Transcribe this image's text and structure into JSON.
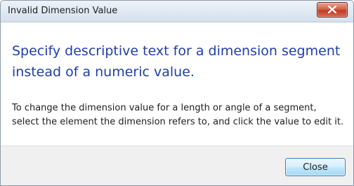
{
  "window": {
    "title": "Invalid Dimension Value"
  },
  "message": {
    "heading": "Specify descriptive text for a dimension segment instead of a numeric value.",
    "body": "To change the dimension value for a length or angle of a segment, select the element the dimension refers to, and click the value to edit it."
  },
  "buttons": {
    "close_label": "Close"
  },
  "icons": {
    "window_close": "close-icon"
  },
  "colors": {
    "heading": "#1f3fa8",
    "close_button_red": "#c03b28"
  }
}
